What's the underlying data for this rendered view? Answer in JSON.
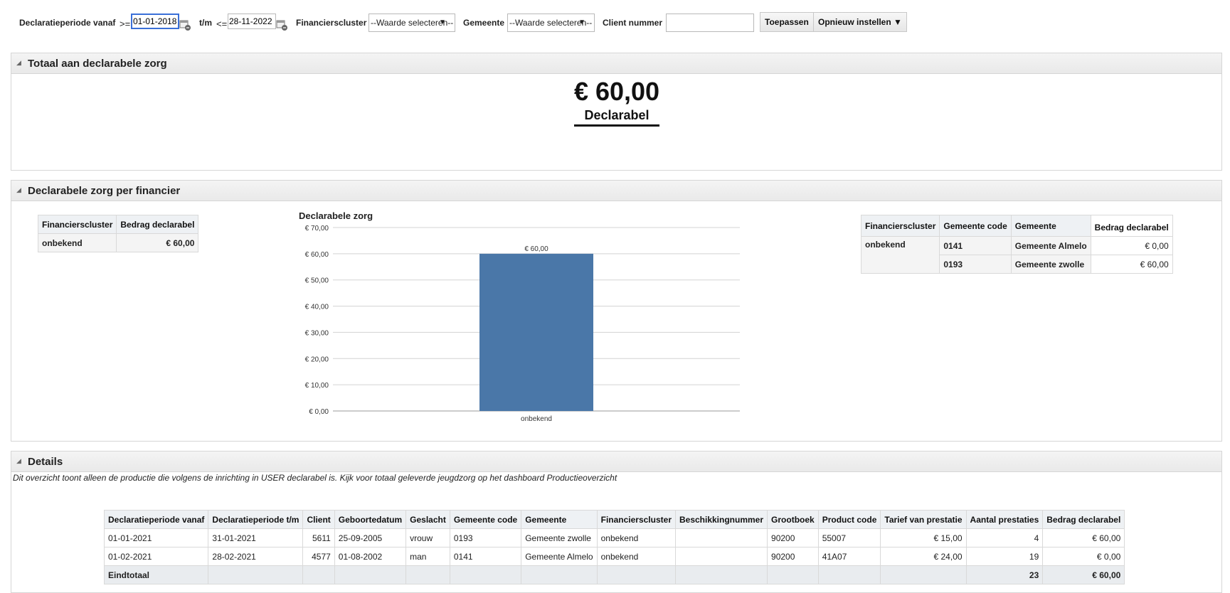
{
  "filters": {
    "period_from_label": "Declaratieperiode vanaf",
    "period_from_op": ">=",
    "period_from_value": "01-01-2018",
    "period_to_label": "t/m",
    "period_to_op": "<=",
    "period_to_value": "28-11-2022",
    "financier_label": "Financierscluster",
    "financier_value": "--Waarde selecteren--",
    "gemeente_label": "Gemeente",
    "gemeente_value": "--Waarde selecteren--",
    "client_label": "Client nummer",
    "client_value": "",
    "apply_button": "Toepassen",
    "reset_button": "Opnieuw instellen ▼"
  },
  "total_panel": {
    "title": "Totaal aan declarabele zorg",
    "kpi_value": "€ 60,00",
    "kpi_label": "Declarabel"
  },
  "financier_panel": {
    "title": "Declarabele zorg per financier",
    "summary_table": {
      "headers": [
        "Financierscluster",
        "Bedrag declarabel"
      ],
      "rows": [
        [
          "onbekend",
          "€ 60,00"
        ]
      ]
    },
    "gemeente_table": {
      "headers": [
        "Financierscluster",
        "Gemeente code",
        "Gemeente",
        "Bedrag declarabel"
      ],
      "rows": [
        [
          "onbekend",
          "0141",
          "Gemeente Almelo",
          "€ 0,00"
        ],
        [
          "",
          "0193",
          "Gemeente zwolle",
          "€ 60,00"
        ]
      ]
    }
  },
  "chart_data": {
    "type": "bar",
    "title": "Declarabele zorg",
    "categories": [
      "onbekend"
    ],
    "values": [
      60
    ],
    "value_labels": [
      "€ 60,00"
    ],
    "ylim": [
      0,
      70
    ],
    "yticks": [
      0,
      10,
      20,
      30,
      40,
      50,
      60,
      70
    ],
    "ytick_labels": [
      "€ 0,00",
      "€ 10,00",
      "€ 20,00",
      "€ 30,00",
      "€ 40,00",
      "€ 50,00",
      "€ 60,00",
      "€ 70,00"
    ],
    "grid": true,
    "bar_color": "#4a77a8"
  },
  "details_panel": {
    "title": "Details",
    "note": "Dit overzicht toont alleen de productie die volgens de inrichting in USER declarabel is. Kijk voor totaal geleverde jeugdzorg op het dashboard Productieoverzicht",
    "headers": [
      "Declaratieperiode vanaf",
      "Declaratieperiode t/m",
      "Client",
      "Geboortedatum",
      "Geslacht",
      "Gemeente code",
      "Gemeente",
      "Financierscluster",
      "Beschikkingnummer",
      "Grootboek",
      "Product code",
      "Tarief van prestatie",
      "Aantal prestaties",
      "Bedrag declarabel"
    ],
    "rows": [
      [
        "01-01-2021",
        "31-01-2021",
        "5611",
        "25-09-2005",
        "vrouw",
        "0193",
        "Gemeente zwolle",
        "onbekend",
        "",
        "90200",
        "55007",
        "€ 15,00",
        "4",
        "€ 60,00"
      ],
      [
        "01-02-2021",
        "28-02-2021",
        "4577",
        "01-08-2002",
        "man",
        "0141",
        "Gemeente Almelo",
        "onbekend",
        "",
        "90200",
        "41A07",
        "€ 24,00",
        "19",
        "€ 0,00"
      ]
    ],
    "total_row": [
      "Eindtotaal",
      "",
      "",
      "",
      "",
      "",
      "",
      "",
      "",
      "",
      "",
      "",
      "23",
      "€ 60,00"
    ]
  }
}
